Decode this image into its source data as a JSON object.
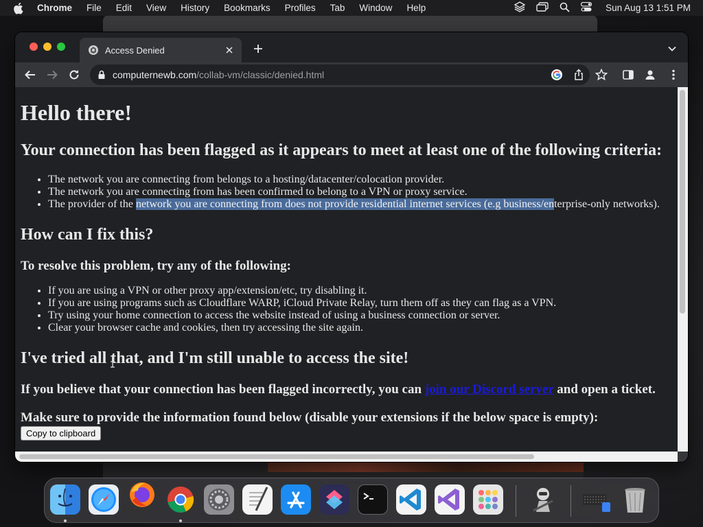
{
  "menubar": {
    "app_name": "Chrome",
    "items": [
      "File",
      "Edit",
      "View",
      "History",
      "Bookmarks",
      "Profiles",
      "Tab",
      "Window",
      "Help"
    ],
    "clock": "Sun Aug 13  1:51 PM"
  },
  "browser": {
    "tab_title": "Access Denied",
    "url_host": "computernewb.com",
    "url_path": "/collab-vm/classic/denied.html"
  },
  "page": {
    "heading": "Hello there!",
    "criteria_heading": "Your connection has been flagged as it appears to meet at least one of the following criteria:",
    "criteria": {
      "item1": "The network you are connecting from belongs to a hosting/datacenter/colocation provider.",
      "item2": "The network you are connecting from has been confirmed to belong to a VPN or proxy service.",
      "item3_before": "The provider of the ",
      "item3_selected": "network you are connecting from does not provide residential internet services (e.g business/en",
      "item3_after": "terprise-only networks)."
    },
    "fix_heading": "How can I fix this?",
    "fix_subheading": "To resolve this problem, try any of the following:",
    "fixes": [
      "If you are using a VPN or other proxy app/extension/etc, try disabling it.",
      "If you are using programs such as Cloudflare WARP, iCloud Private Relay, turn them off as they can flag as a VPN.",
      "Try using your home connection to access the website instead of using a business connection or server.",
      "Clear your browser cache and cookies, then try accessing the site again."
    ],
    "still_heading": "I've tried all that, and I'm still unable to access the site!",
    "discord_before": "If you believe that your connection has been flagged incorrectly, you can ",
    "discord_link": "join our Discord server",
    "discord_after": " and open a ticket.",
    "info_heading": "Make sure to provide the information found below (disable your extensions if the below space is empty):",
    "copy_button": "Copy to clipboard"
  },
  "dock": {
    "apps": [
      "finder-icon",
      "safari-icon",
      "firefox-icon",
      "chrome-icon",
      "system-settings-icon",
      "textedit-icon",
      "app-store-icon",
      "shortcuts-icon",
      "terminal-icon",
      "vscode-icon",
      "visual-studio-icon",
      "launchpad-icon",
      "automator-icon",
      "downloads-stack-icon",
      "trash-icon"
    ]
  }
}
